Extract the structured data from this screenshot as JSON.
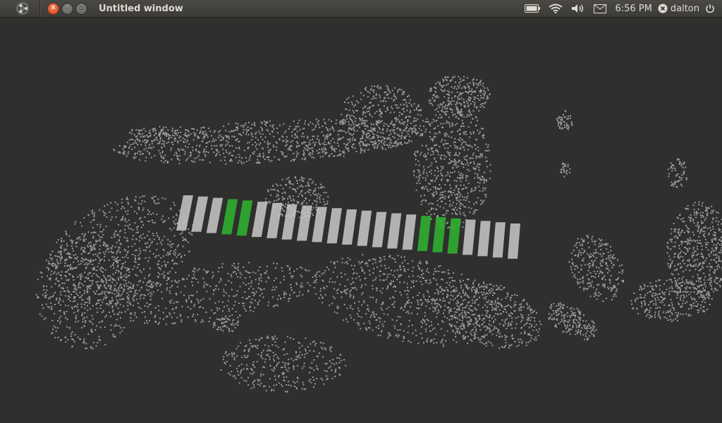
{
  "window": {
    "title": "Untitled window"
  },
  "panel": {
    "clock": "6:56 PM",
    "user": "dalton",
    "icons": {
      "launcher": "ubuntu-logo-icon",
      "battery": "battery-icon",
      "wifi": "wifi-icon",
      "volume": "volume-icon",
      "mail": "mail-icon",
      "user_status": "user-status-icon",
      "power": "power-icon"
    },
    "window_buttons": [
      "close",
      "minimize",
      "maximize"
    ]
  },
  "scene": {
    "background": "#2f2f2e",
    "point_color": "#9a9a9a",
    "bar_color": "#c9c9c9",
    "highlight_color": "#2fae2f"
  }
}
